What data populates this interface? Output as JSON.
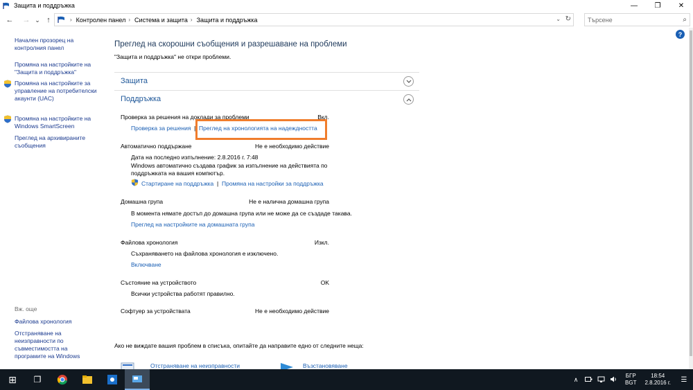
{
  "window": {
    "title": "Защита и поддръжка",
    "minimize": "—",
    "maximize": "❐",
    "close": "✕"
  },
  "address": {
    "back": "←",
    "forward": "→",
    "recent": "⌄",
    "up": "↑",
    "crumbs": [
      "Контролен панел",
      "Система и защита",
      "Защита и поддръжка"
    ],
    "crumb_sep": "›",
    "dropdown": "⌄",
    "refresh": "↻",
    "search_placeholder": "Търсене",
    "search_icon": "⌕"
  },
  "help": "?",
  "left": {
    "links": [
      "Начален прозорец на контролния панел",
      "Промяна на настройките на \"Защита и поддръжка\"",
      "Промяна на настройките за управление на потребителски акаунти (UAC)",
      "Промяна на настройките на Windows SmartScreen",
      "Преглед на архивираните съобщения"
    ],
    "see_also": "Вж. още",
    "see_also_links": [
      "Файлова хронология",
      "Отстраняване на неизправности по съвместимостта на програмите на Windows"
    ]
  },
  "main": {
    "title": "Преглед на скорошни съобщения и разрешаване на проблеми",
    "subtitle": "\"Защита и поддръжка\" не откри проблеми.",
    "security": "Защита",
    "maintenance": "Поддръжка",
    "items": {
      "problem_reports": {
        "label": "Проверка за решения на доклади за проблеми",
        "status": "Вкл.",
        "link1": "Проверка за решения",
        "link2": "Преглед на хронологията на надеждността"
      },
      "auto_maintenance": {
        "label": "Автоматично поддържане",
        "status": "Не е необходимо действие",
        "last_run": "Дата на последно изпълнение: 2.8.2016 г. 7:48",
        "desc": "Windows автоматично създава график за изпълнение на действията по поддръжката на вашия компютър.",
        "link1": "Стартиране на поддръжка",
        "link2": "Промяна на настройки за поддръжка"
      },
      "homegroup": {
        "label": "Домашна група",
        "status": "Не е налична домашна група",
        "desc": "В момента нямате достъп до домашна група или не може да се създаде такава.",
        "link": "Преглед на настройките на домашната група"
      },
      "file_history": {
        "label": "Файлова хронология",
        "status": "Изкл.",
        "desc": "Съхраняването на файлова хронология е изключено.",
        "link": "Включване"
      },
      "device_status": {
        "label": "Състояние на устройството",
        "status": "OK",
        "desc": "Всички устройства работят правилно."
      },
      "device_software": {
        "label": "Софтуер за устройствата",
        "status": "Не е необходимо действие"
      }
    },
    "footer": "Ако не виждате вашия проблем в списъка, опитайте да направите едно от следните неща:",
    "footer_links": [
      "Отстраняване на неизправности",
      "Възстановяване"
    ]
  },
  "taskbar": {
    "start": "⊞",
    "task_view": "❐",
    "lang_top": "БГР",
    "lang_bottom": "BGT",
    "time": "18:54",
    "date": "2.8.2016 г.",
    "tray_up": "∧",
    "notif": "☰"
  },
  "colors": {
    "link": "#1a5fb4",
    "heading": "#1e395b",
    "highlight": "#f07d2c",
    "taskbar": "#101820"
  }
}
